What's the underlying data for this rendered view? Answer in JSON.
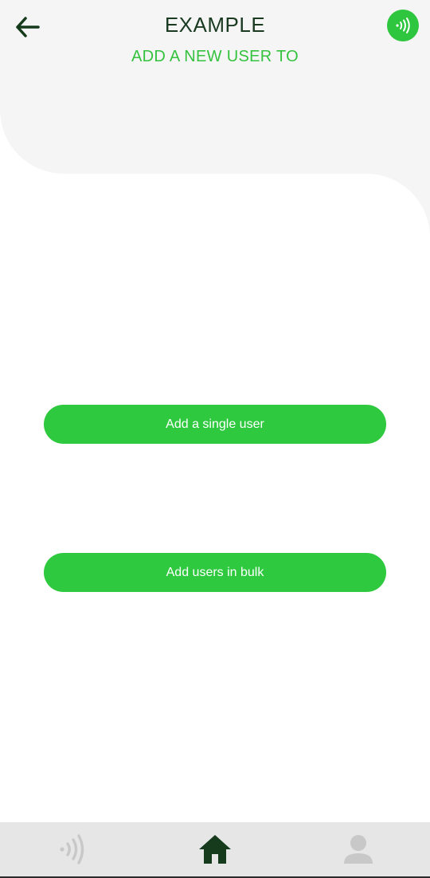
{
  "header": {
    "title": "EXAMPLE",
    "subtitle": "ADD A NEW USER TO",
    "back_icon": "arrow-left-icon",
    "nfc_icon": "nfc-icon"
  },
  "actions": {
    "single_label": "Add a single user",
    "bulk_label": "Add users in bulk"
  },
  "bottom_nav": {
    "items": [
      {
        "icon": "nfc-icon",
        "active": false
      },
      {
        "icon": "home-icon",
        "active": true
      },
      {
        "icon": "user-icon",
        "active": false
      }
    ]
  },
  "colors": {
    "accent": "#2ec93f",
    "title": "#1b3a22",
    "header_bg": "#f5f5f5",
    "nav_bg": "#e6e6e6",
    "nav_inactive": "#c8c8c8",
    "nav_active": "#163b1c"
  }
}
